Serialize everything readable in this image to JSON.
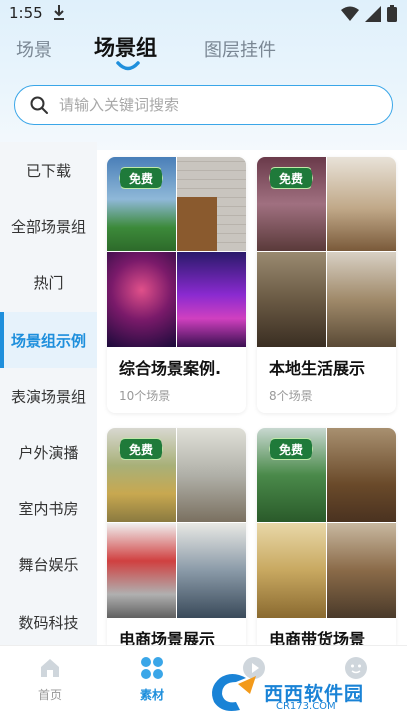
{
  "status_bar": {
    "time": "1:55"
  },
  "tabs": [
    {
      "label": "场景",
      "active": false
    },
    {
      "label": "场景组",
      "active": true
    },
    {
      "label": "图层挂件",
      "active": false
    }
  ],
  "search": {
    "placeholder": "请输入关键词搜索"
  },
  "sidebar": {
    "items": [
      {
        "label": "已下载"
      },
      {
        "label": "全部场景组"
      },
      {
        "label": "热门"
      },
      {
        "label": "场景组示例",
        "active": true
      },
      {
        "label": "表演场景组"
      },
      {
        "label": "户外演播"
      },
      {
        "label": "室内书房"
      },
      {
        "label": "舞台娱乐"
      },
      {
        "label": "数码科技"
      }
    ]
  },
  "cards": [
    {
      "badge": "免费",
      "title": "综合场景案例.",
      "subtitle": "10个场景"
    },
    {
      "badge": "免费",
      "title": "本地生活展示",
      "subtitle": "8个场景"
    },
    {
      "badge": "免费",
      "title": "电商场景展示",
      "subtitle": ""
    },
    {
      "badge": "免费",
      "title": "电商带货场景",
      "subtitle": ""
    }
  ],
  "bottom_nav": [
    {
      "label": "首页",
      "icon": "home-icon",
      "active": false
    },
    {
      "label": "素材",
      "icon": "grid-icon",
      "active": true
    },
    {
      "label": "",
      "icon": "play-icon",
      "active": false
    },
    {
      "label": "",
      "icon": "profile-icon",
      "active": false
    }
  ],
  "watermark": {
    "logo": "C",
    "brand": "西西软件园",
    "domain": "CR173.COM"
  },
  "colors": {
    "accent": "#1e8fdc",
    "badge_green": "#1f7a3a",
    "search_border": "#3aa6e8"
  }
}
